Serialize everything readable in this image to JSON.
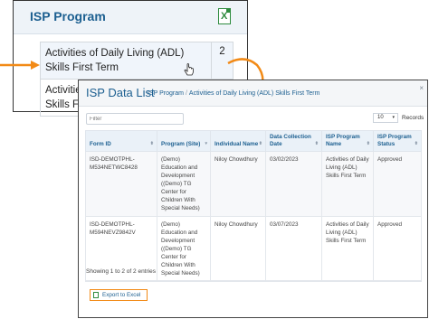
{
  "program_card": {
    "title": "ISP Program",
    "rows": [
      {
        "name": "Activities of Daily Living (ADL) Skills First Term",
        "count": "2"
      },
      {
        "name": "Activities of Daily Living (ADL) Skills First Term 1",
        "count": ""
      }
    ],
    "icons": {
      "excel": "excel-icon",
      "cursor": "hand-cursor-icon"
    }
  },
  "modal": {
    "title": "ISP Data List",
    "breadcrumb": [
      "ISP Program",
      "Activities of Daily Living (ADL) Skills First Term"
    ],
    "close": "×",
    "filter_placeholder": "Filter",
    "page_size": "10",
    "records_label": "Records",
    "columns": [
      "Form ID",
      "Program (Site)",
      "Individual Name",
      "Data Collection Date",
      "ISP Program Name",
      "ISP Program Status"
    ],
    "rows": [
      {
        "form_id": "ISD-DEMOTPHL-M534NETWC8428",
        "program": "(Demo) Education and Development ((Demo) TG Center for Children With Special Needs)",
        "individual": "Niloy Chowdhury",
        "date": "03/02/2023",
        "isp_program": "Activities of Daily Living (ADL) Skills First Term",
        "status": "Approved"
      },
      {
        "form_id": "ISD-DEMOTPHL-M594NEVZ9842V",
        "program": "(Demo) Education and Development ((Demo) TG Center for Children With Special Needs)",
        "individual": "Niloy Chowdhury",
        "date": "03/07/2023",
        "isp_program": "Activities of Daily Living (ADL) Skills First Term",
        "status": "Approved"
      }
    ],
    "showing": "Showing 1 to 2 of 2 entries",
    "export_label": "Export to Excel"
  },
  "colors": {
    "accent": "#1c5f90",
    "highlight": "#f28a16",
    "excel_green": "#2e8b3e"
  }
}
